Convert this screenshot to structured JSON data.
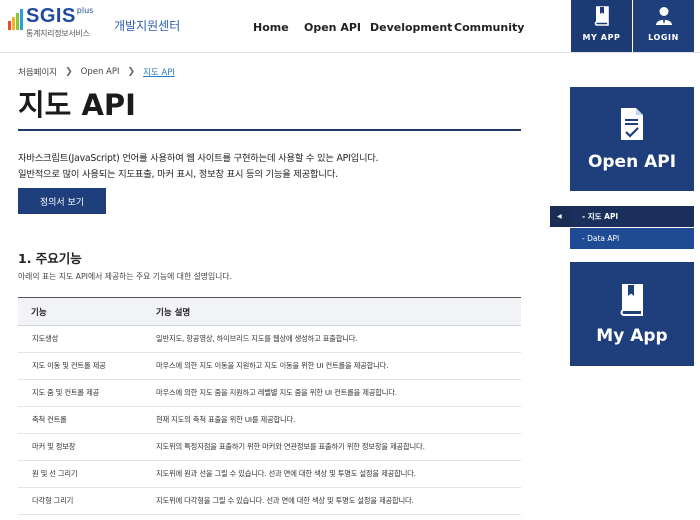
{
  "header": {
    "logo_text": "SGIS",
    "logo_plus": "plus",
    "logo_sub": "통계지리정보서비스",
    "logo_center": "개발지원센터",
    "brand_colors": [
      "#e94a2f",
      "#f3b21a",
      "#8cc63f",
      "#2d9fd8",
      "#1e4aa0"
    ],
    "nav": [
      "Home",
      "Open API",
      "Development",
      "Community"
    ],
    "myapp_label": "MY APP",
    "login_label": "LOGIN"
  },
  "breadcrumb": [
    "처음페이지",
    "Open API",
    "지도 API"
  ],
  "main": {
    "title": "지도 API",
    "desc_line1": "자바스크립트(JavaScript) 언어를 사용하여 웹 사이트를 구현하는데 사용할 수 있는 API입니다.",
    "desc_line2": "일반적으로 많이 사용되는 지도표출, 마커 표시, 정보창 표시 등의 기능을 제공합니다.",
    "spec_button": "정의서 보기",
    "section_title": "1. 주요기능",
    "section_desc": "아래의 표는 지도 API에서 제공하는 주요 기능에 대한 설명입니다.",
    "table": {
      "headers": [
        "기능",
        "기능 설명"
      ],
      "rows": [
        [
          "지도생성",
          "일반지도, 항공영상, 하이브리드 지도를 웹상에 생성하고 표출합니다."
        ],
        [
          "지도 이동 및 컨트롤 제공",
          "마우스에 의한 지도 이동을 지원하고 지도 이동을 위한 UI 컨트롤을 제공합니다."
        ],
        [
          "지도 줌 및 컨트롤 제공",
          "마우스에 의한 지도 줌을 지원하고 레벨별 지도 줌을 위한 UI 컨트롤을 제공합니다."
        ],
        [
          "축척 컨트롤",
          "현재 지도의 축척 표출을 위한 UI를 제공합니다."
        ],
        [
          "마커 및 정보창",
          "지도위의 특정지점을 표출하기 위한 마커와 연관정보를 표출하기 위한 정보창을 제공합니다."
        ],
        [
          "원 및 선 그리기",
          "지도위에 원과 선을 그릴 수 있습니다. 선과 면에 대한 색상 및 투명도 설정을 제공합니다."
        ],
        [
          "다각형 그리기",
          "지도위에 다각형을 그릴 수 있습니다. 선과 면에 대한 색상 및 투명도 설정을 제공합니다."
        ]
      ]
    }
  },
  "sidebar": {
    "openapi_card": "Open API",
    "menu": [
      "- 지도 API",
      "- Data API"
    ],
    "myapp_card": "My App",
    "accent_color": "#1e3f7c"
  }
}
